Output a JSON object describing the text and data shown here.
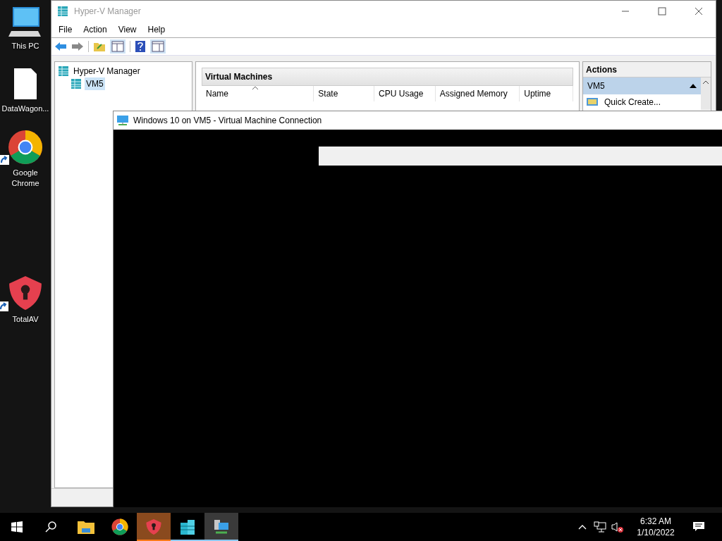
{
  "desktop_icons": [
    {
      "label": "This PC",
      "kind": "pc",
      "shortcut": false
    },
    {
      "label": "DataWagon...",
      "kind": "file",
      "shortcut": false
    },
    {
      "label": "Google Chrome",
      "kind": "chrome",
      "shortcut": true
    },
    {
      "label": "TotalAV",
      "kind": "shield",
      "shortcut": true
    }
  ],
  "manager": {
    "title": "Hyper-V Manager",
    "menu": [
      "File",
      "Action",
      "View",
      "Help"
    ],
    "tree": [
      {
        "label": "Hyper-V Manager",
        "selected": false,
        "children": [
          {
            "label": "VM5",
            "selected": true
          }
        ]
      }
    ],
    "vm_panel": {
      "title": "Virtual Machines",
      "columns": [
        {
          "label": "Name",
          "sorted": true
        },
        {
          "label": "State",
          "sorted": false
        },
        {
          "label": "CPU Usage",
          "sorted": false
        },
        {
          "label": "Assigned Memory",
          "sorted": false
        },
        {
          "label": "Uptime",
          "sorted": false
        }
      ]
    },
    "actions": {
      "title": "Actions",
      "group": "VM5",
      "expanded": true,
      "items": [
        "Quick Create..."
      ]
    }
  },
  "vm_connection": {
    "title": "Windows 10 on VM5 - Virtual Machine Connection"
  },
  "taskbar": {
    "items": [
      {
        "kind": "explorer",
        "running": false,
        "active": false
      },
      {
        "kind": "chrome",
        "running": false,
        "active": false
      },
      {
        "kind": "shield",
        "running": true,
        "active": true
      },
      {
        "kind": "hyperv",
        "running": true,
        "active": false
      },
      {
        "kind": "vmconnect",
        "running": true,
        "active": true
      }
    ],
    "time": "6:32 AM",
    "date": "1/10/2022"
  }
}
